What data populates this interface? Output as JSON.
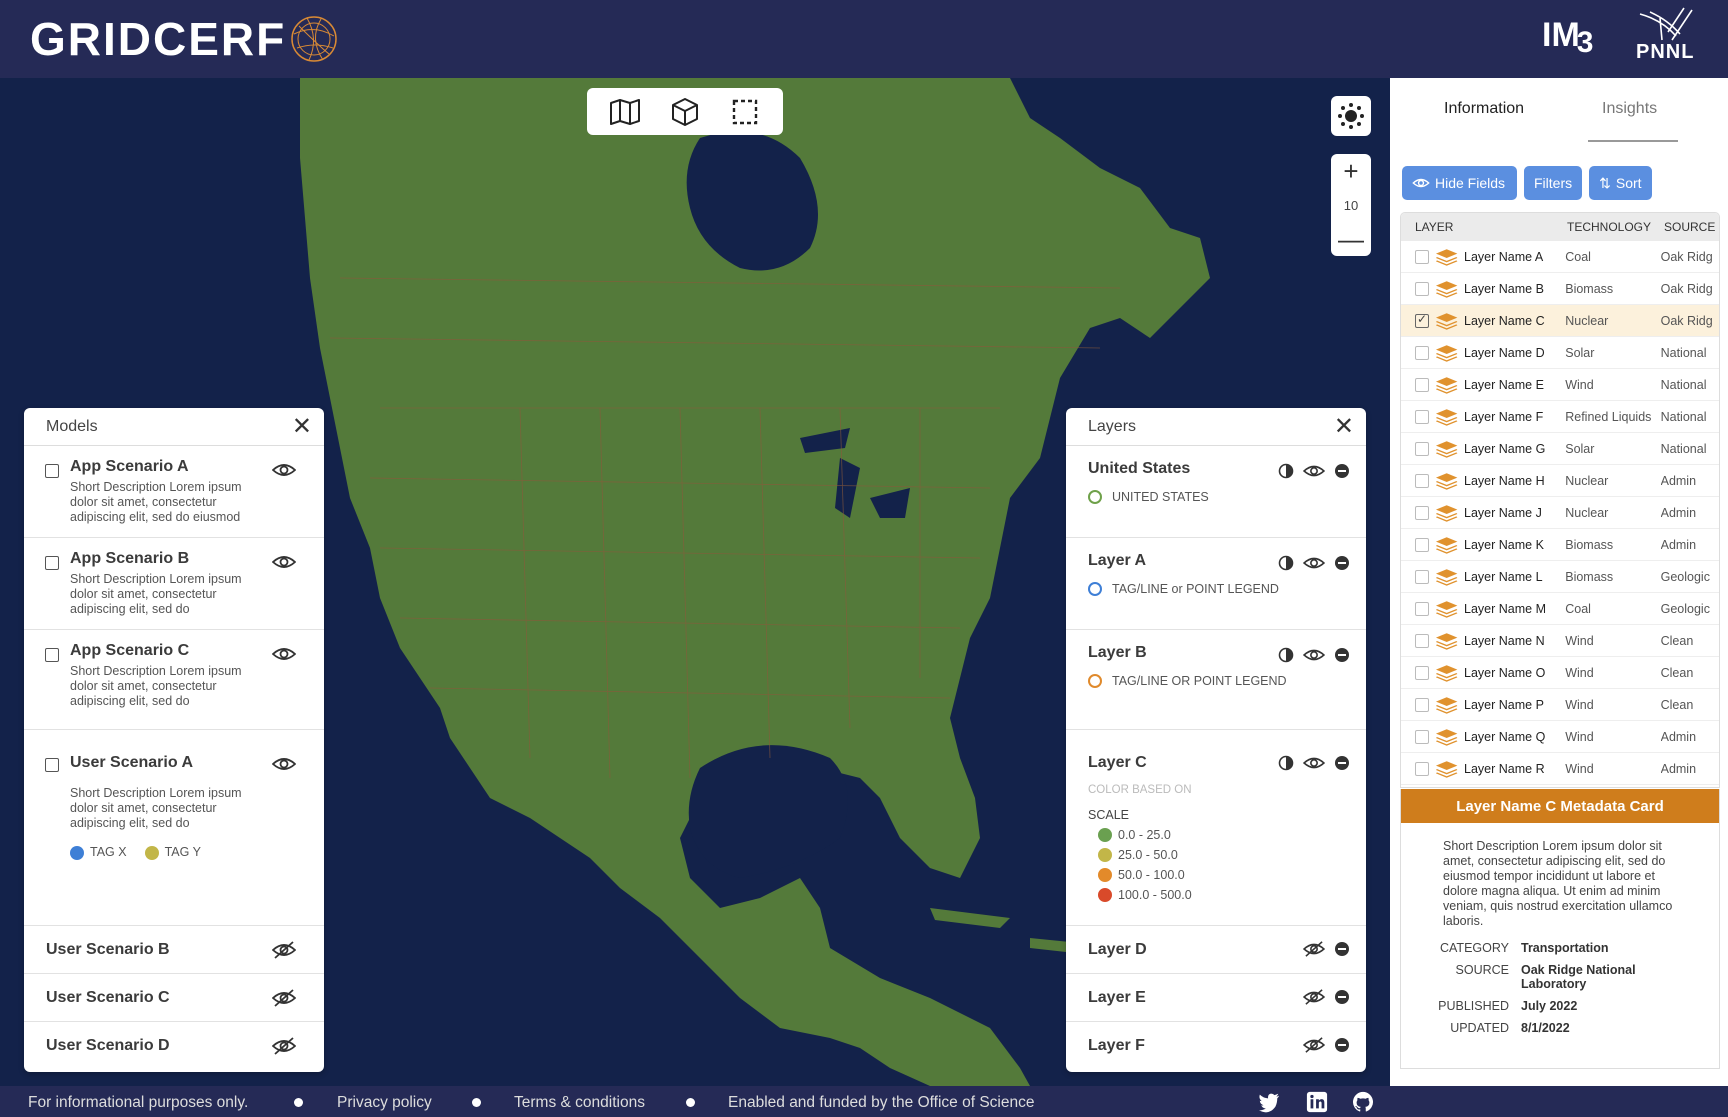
{
  "header": {
    "title": "GRIDCERF",
    "partner_im3": "IM",
    "partner_im3_sub": "3",
    "partner_pnnl": "PNNL"
  },
  "map_tools": [
    "map-icon",
    "cube-icon",
    "select-box-icon"
  ],
  "zoom": {
    "plus": "+",
    "level": "10",
    "minus": "—"
  },
  "models": {
    "title": "Models",
    "items": [
      {
        "title": "App Scenario A",
        "desc": "Short Description Lorem ipsum dolor sit amet, consectetur adipiscing elit, sed do eiusmod"
      },
      {
        "title": "App Scenario B",
        "desc": "Short Description Lorem ipsum dolor sit amet, consectetur adipiscing elit, sed do"
      },
      {
        "title": "App Scenario C",
        "desc": "Short Description Lorem ipsum dolor sit amet, consectetur adipiscing elit, sed do"
      },
      {
        "title": "User Scenario A",
        "desc": "Short Description Lorem ipsum dolor sit amet, consectetur adipiscing elit, sed do",
        "tags": [
          "TAG X",
          "TAG Y"
        ]
      }
    ],
    "hidden": [
      "User Scenario B",
      "User Scenario C",
      "User Scenario D"
    ]
  },
  "layers": {
    "title": "Layers",
    "items": [
      {
        "title": "United States",
        "legend": "UNITED STATES",
        "color": "#6fa14a"
      },
      {
        "title": "Layer A",
        "legend": "TAG/LINE or POINT LEGEND",
        "color": "#3e7fd6"
      },
      {
        "title": "Layer B",
        "legend": "TAG/LINE OR POINT LEGEND",
        "color": "#e08a2c"
      }
    ],
    "layer_c": {
      "title": "Layer C",
      "based_on": "COLOR BASED ON",
      "scale_label": "SCALE",
      "scale": [
        {
          "range": "0.0 - 25.0",
          "color": "#6aa050"
        },
        {
          "range": "25.0 - 50.0",
          "color": "#c2b648"
        },
        {
          "range": "50.0 - 100.0",
          "color": "#e38a2a"
        },
        {
          "range": "100.0 - 500.0",
          "color": "#d94a2a"
        }
      ]
    },
    "hidden": [
      "Layer D",
      "Layer E",
      "Layer F"
    ]
  },
  "side": {
    "tabs": [
      "Information",
      "Insights"
    ],
    "buttons": {
      "hide": "Hide Fields",
      "filters": "Filters",
      "sort": "Sort"
    },
    "columns": [
      "LAYER",
      "TECHNOLOGY",
      "SOURCE"
    ],
    "rows": [
      {
        "name": "Layer Name A",
        "tech": "Coal",
        "source": "Oak Ridg"
      },
      {
        "name": "Layer Name B",
        "tech": "Biomass",
        "source": "Oak Ridg"
      },
      {
        "name": "Layer Name C",
        "tech": "Nuclear",
        "source": "Oak Ridg",
        "selected": true
      },
      {
        "name": "Layer Name D",
        "tech": "Solar",
        "source": "National"
      },
      {
        "name": "Layer Name E",
        "tech": "Wind",
        "source": "National"
      },
      {
        "name": "Layer Name F",
        "tech": "Refined Liquids",
        "source": "National"
      },
      {
        "name": "Layer Name G",
        "tech": "Solar",
        "source": "National"
      },
      {
        "name": "Layer Name H",
        "tech": "Nuclear",
        "source": "Admin"
      },
      {
        "name": "Layer Name J",
        "tech": "Nuclear",
        "source": "Admin"
      },
      {
        "name": "Layer Name K",
        "tech": "Biomass",
        "source": "Admin"
      },
      {
        "name": "Layer Name L",
        "tech": "Biomass",
        "source": "Geologic"
      },
      {
        "name": "Layer Name M",
        "tech": "Coal",
        "source": "Geologic"
      },
      {
        "name": "Layer Name N",
        "tech": "Wind",
        "source": "Clean"
      },
      {
        "name": "Layer Name O",
        "tech": "Wind",
        "source": "Clean"
      },
      {
        "name": "Layer Name P",
        "tech": "Wind",
        "source": "Clean"
      },
      {
        "name": "Layer Name Q",
        "tech": "Wind",
        "source": "Admin"
      },
      {
        "name": "Layer Name R",
        "tech": "Wind",
        "source": "Admin"
      }
    ],
    "meta": {
      "title": "Layer Name C Metadata Card",
      "desc": "Short Description Lorem ipsum dolor sit amet, consectetur adipiscing elit, sed do eiusmod tempor incididunt ut labore et dolore magna aliqua. Ut enim ad minim veniam, quis nostrud exercitation ullamco laboris.",
      "fields": [
        {
          "k": "CATEGORY",
          "v": "Transportation"
        },
        {
          "k": "SOURCE",
          "v": "Oak Ridge National Laboratory"
        },
        {
          "k": "PUBLISHED",
          "v": "July 2022"
        },
        {
          "k": "UPDATED",
          "v": "8/1/2022"
        }
      ]
    }
  },
  "footer": {
    "items": [
      "For informational purposes only.",
      "Privacy policy",
      "Terms & conditions",
      "Enabled and funded by the Office of Science"
    ],
    "social": [
      "twitter-icon",
      "linkedin-icon",
      "github-icon"
    ]
  },
  "colors": {
    "header": "#252a56",
    "ocean": "#13224a",
    "land": "#547a3a",
    "accent": "#5b8fe0",
    "meta_header": "#cf7d1c"
  }
}
